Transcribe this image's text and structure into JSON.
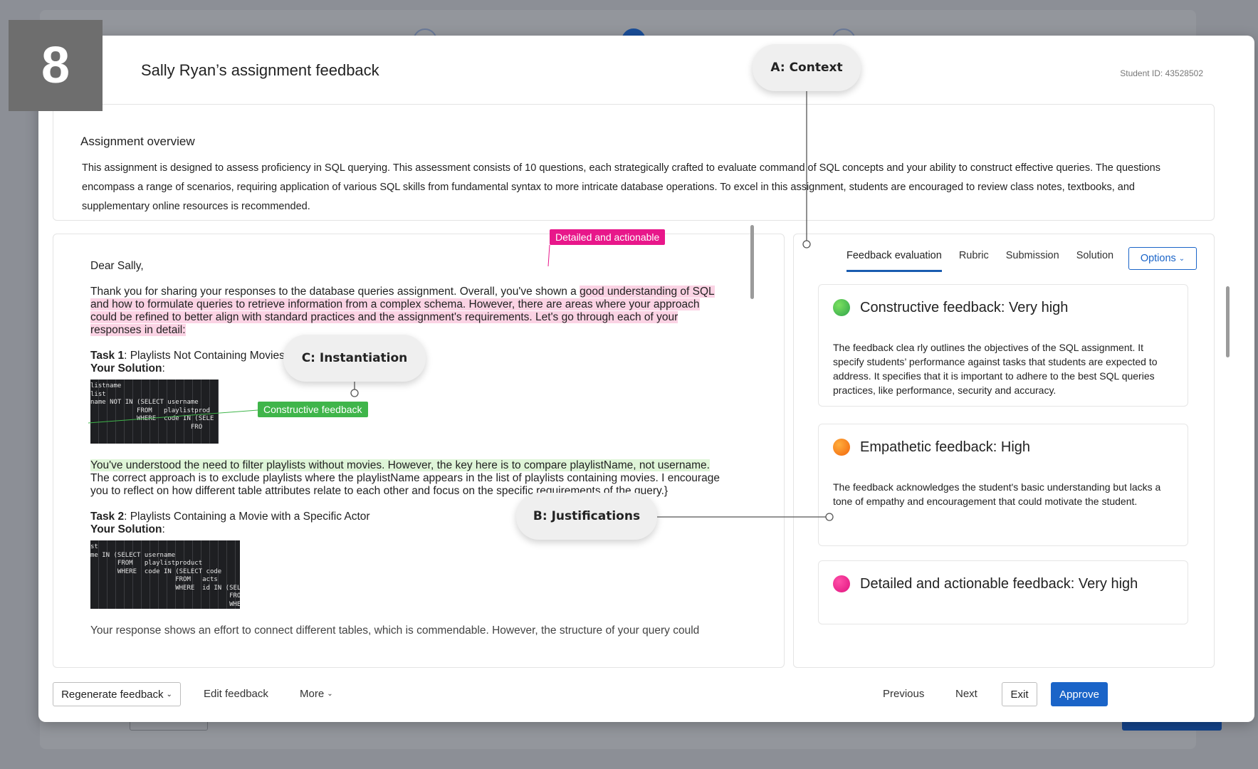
{
  "step_badge": "8",
  "modal": {
    "title": "Sally Ryan’s assignment feedback",
    "student_id": "Student ID: 43528502"
  },
  "overview": {
    "title": "Assignment overview",
    "text": "This assignment is designed to assess proficiency in SQL querying. This assessment consists of 10 questions, each strategically crafted to evaluate command of SQL concepts and your ability to construct effective queries. The questions encompass a range of scenarios, requiring application of various SQL skills from fundamental syntax to more intricate database operations. To excel in this assignment, students are encouraged to review class notes, textbooks, and supplementary online resources is recommended."
  },
  "letter": {
    "greeting": "Dear Sally,",
    "intro_plain": "Thank you for sharing your responses to the database queries assignment. Overall, you've shown a ",
    "intro_highlight": "good understanding of SQL and how to formulate queries to retrieve information from a complex schema. However, there are areas where your approach could be refined to better align with standard practices and the assignment's requirements. Let's go through each of your responses in detail:",
    "task1_label": "Task 1",
    "task1_title": ": Playlists Not Containing Movies",
    "task2_label": "Task 2",
    "task2_title": ": Playlists Containing a Movie with a Specific Actor",
    "your_solution": "Your Solution",
    "colon": ":",
    "task1_feedback_highlight": "You've understood the need to filter playlists without movies. However, the key here is to compare playlistName, not username.",
    "task1_feedback_plain": " The correct approach is to exclude playlists where the playlistName appears in the list of playlists containing movies. I encourage you to reflect on how different table attributes relate to each other and focus on the specific requirements of the query.}",
    "cutoff": "Your response shows an effort to connect different tables, which is commendable. However, the structure of your query could",
    "code1": [
      "listname",
      "list",
      "name NOT IN (SELECT username",
      "            FROM   playlistprod",
      "            WHERE  code IN (SELE",
      "                          FRO"
    ],
    "code2": [
      "st",
      "me IN (SELECT username",
      "       FROM   playlistproduct",
      "       WHERE  code IN (SELECT code",
      "                      FROM   acts",
      "                      WHERE  id IN (SELECT id",
      "                                    FROM   castme",
      "                                    WHERE  lastna"
    ]
  },
  "tags": {
    "detailed": "Detailed and actionable",
    "constructive": "Constructive feedback"
  },
  "callouts": {
    "a": "A: Context",
    "b": "B: Justifications",
    "c": "C: Instantiation"
  },
  "tabs": [
    "Feedback evaluation",
    "Rubric",
    "Submission",
    "Solution"
  ],
  "options_label": "Options",
  "cards": [
    {
      "title": "Constructive feedback: Very high",
      "color": "#3fb54a",
      "body": "The feedback clea rly outlines the objectives of the SQL assignment. It specify students’ performance against tasks that students are expected to address. It specifies that it is important to adhere to the best SQL queries practices, like performance, security and accuracy."
    },
    {
      "title": "Empathetic feedback: High",
      "color": "#f2650a",
      "body": "The feedback acknowledges the student's basic understanding but lacks a tone of empathy and encouragement that could motivate the student."
    },
    {
      "title": "Detailed and actionable feedback: Very high",
      "color": "#e0137f",
      "body": ""
    }
  ],
  "footer": {
    "regenerate": "Regenerate feedback",
    "edit": "Edit feedback",
    "more": "More",
    "previous": "Previous",
    "next": "Next",
    "exit": "Exit",
    "approve": "Approve"
  }
}
